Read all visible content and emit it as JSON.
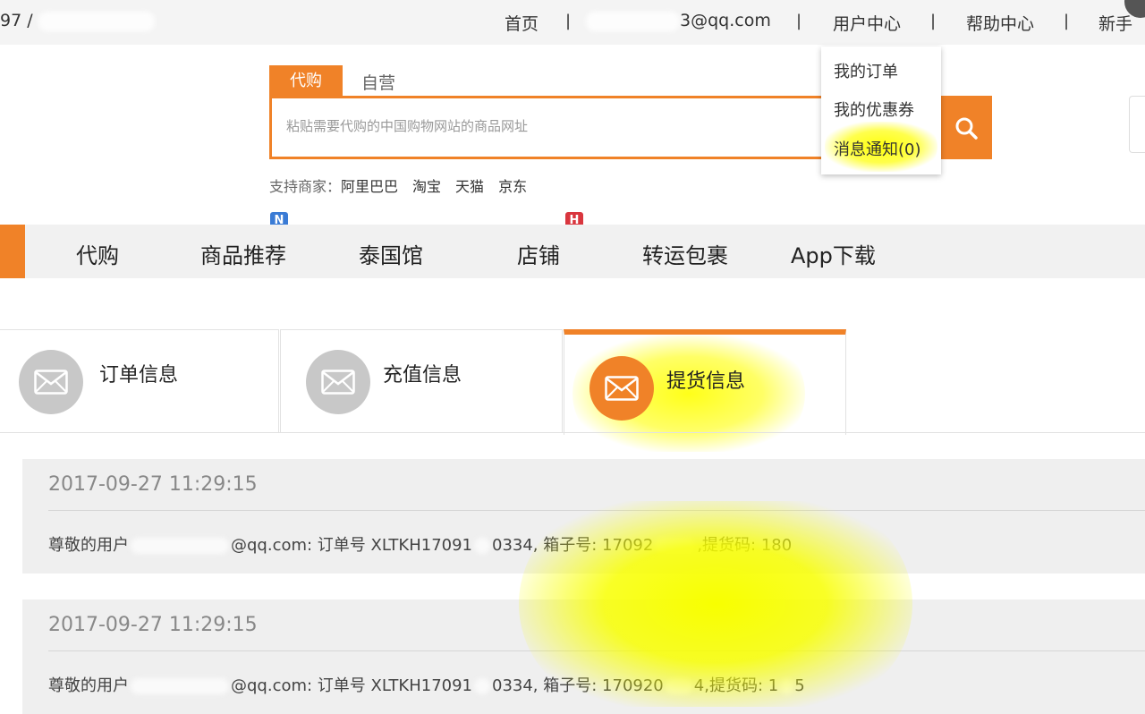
{
  "topbar": {
    "left_fragment": "97 /",
    "items": [
      {
        "label": "首页"
      },
      {
        "label": "3@qq.com"
      },
      {
        "label": "用户中心"
      },
      {
        "label": "帮助中心"
      },
      {
        "label": "新手"
      }
    ],
    "separator": "|"
  },
  "user_menu": {
    "items": [
      {
        "label": "我的订单"
      },
      {
        "label": "我的优惠券"
      },
      {
        "label": "消息通知(0)"
      }
    ]
  },
  "search": {
    "tabs": [
      {
        "label": "代购",
        "active": true
      },
      {
        "label": "自营",
        "active": false
      }
    ],
    "placeholder": "粘贴需要代购的中国购物网站的商品网址",
    "icon": "search-icon",
    "support_label": "支持商家：",
    "supported_shops": [
      "阿里巴巴",
      "淘宝",
      "天猫",
      "京东"
    ]
  },
  "nav": {
    "items": [
      {
        "label": "代购"
      },
      {
        "label": "商品推荐",
        "badge": "N",
        "badge_color": "#3a7bd5"
      },
      {
        "label": "泰国馆"
      },
      {
        "label": "店铺",
        "badge": "H",
        "badge_color": "#d9363e"
      },
      {
        "label": "转运包裹"
      },
      {
        "label": "App下载"
      }
    ],
    "accent_color": "#f08228"
  },
  "message_tabs": [
    {
      "label": "订单信息",
      "icon": "envelope-icon",
      "active": false
    },
    {
      "label": "充值信息",
      "icon": "envelope-icon",
      "active": false
    },
    {
      "label": "提货信息",
      "icon": "envelope-icon",
      "active": true
    }
  ],
  "messages": [
    {
      "time": "2017-09-27 11:29:15",
      "greeting": "尊敬的用户",
      "body_a": "@qq.com: 订单号 XLTKH17091",
      "body_b": "0334, 箱子号: 17092",
      "body_c": ",提货码: 180"
    },
    {
      "time": "2017-09-27 11:29:15",
      "greeting": "尊敬的用户",
      "body_a": "@qq.com: 订单号 XLTKH17091",
      "body_b": "0334, 箱子号: 170920",
      "body_c": "4,提货码: 1",
      "body_d": "5"
    }
  ],
  "colors": {
    "accent": "#f08228",
    "highlight": "#f8ff00"
  }
}
